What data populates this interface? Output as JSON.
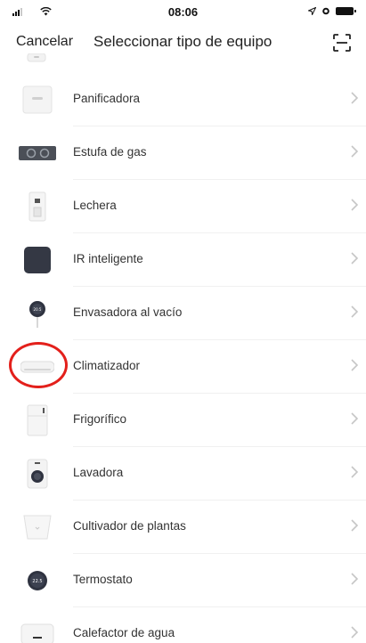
{
  "status_bar": {
    "time": "08:06"
  },
  "nav": {
    "cancel_label": "Cancelar",
    "title": "Seleccionar tipo de equipo",
    "scan_icon": "scan-icon"
  },
  "devices": [
    {
      "label": "Panificadora",
      "icon": "bread-maker-icon"
    },
    {
      "label": "Estufa de gas",
      "icon": "gas-stove-icon"
    },
    {
      "label": "Lechera",
      "icon": "milk-maker-icon"
    },
    {
      "label": "IR inteligente",
      "icon": "ir-remote-icon"
    },
    {
      "label": "Envasadora al vacío",
      "icon": "vacuum-sealer-icon"
    },
    {
      "label": "Climatizador",
      "icon": "air-conditioner-icon"
    },
    {
      "label": "Frigorífico",
      "icon": "fridge-icon"
    },
    {
      "label": "Lavadora",
      "icon": "washing-machine-icon"
    },
    {
      "label": "Cultivador de plantas",
      "icon": "plant-grower-icon"
    },
    {
      "label": "Termostato",
      "icon": "thermostat-icon"
    },
    {
      "label": "Calefactor de agua",
      "icon": "water-heater-icon"
    }
  ],
  "highlight": {
    "target": "Climatizador",
    "color": "#e3201b"
  }
}
